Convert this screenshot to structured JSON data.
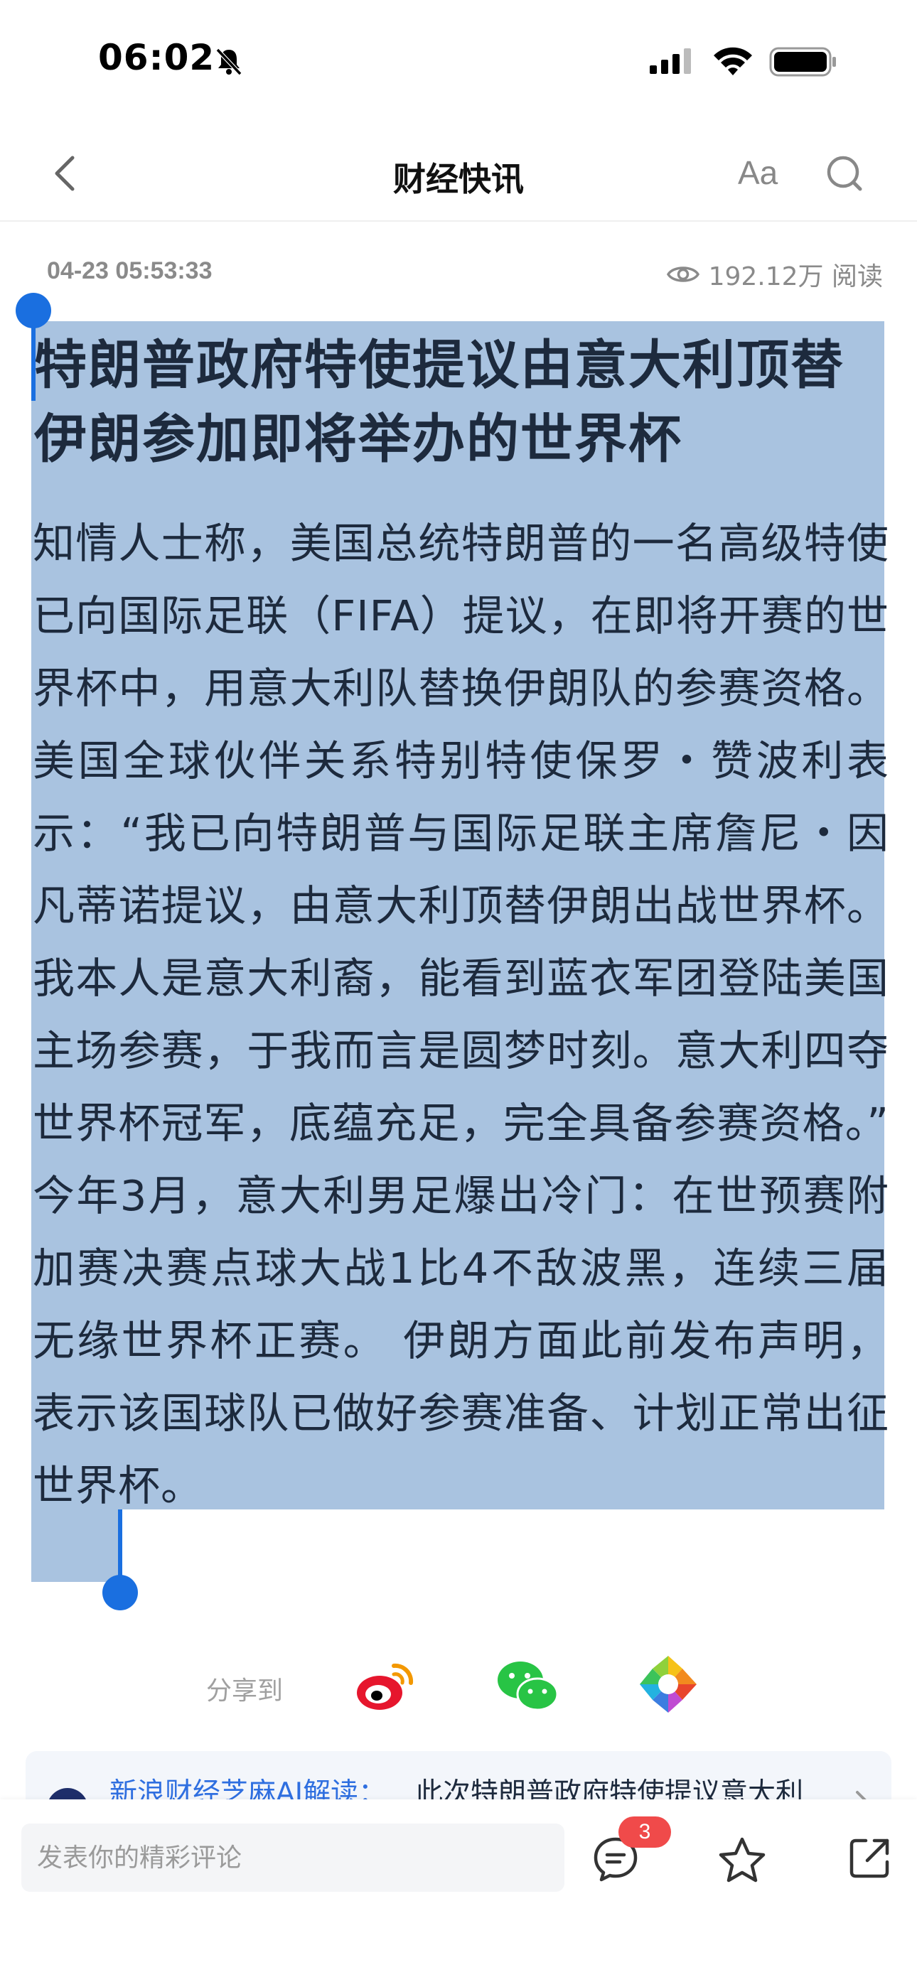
{
  "status_bar": {
    "time": "06:02"
  },
  "nav": {
    "title": "财经快讯",
    "font_size_label": "Aa"
  },
  "meta": {
    "date": "04-23 05:53:33",
    "views": "192.12万 阅读"
  },
  "article": {
    "title": "特朗普政府特使提议由意大利顶替伊朗参加即将举办的世界杯",
    "body": "知情人士称，美国总统特朗普的一名高级特使已向国际足联（FIFA）提议，在即将开赛的世界杯中，用意大利队替换伊朗队的参赛资格。 美国全球伙伴关系特别特使保罗・赞波利表示：“我已向特朗普与国际足联主席詹尼・因凡蒂诺提议，由意大利顶替伊朗出战世界杯。我本人是意大利裔，能看到蓝衣军团登陆美国主场参赛，于我而言是圆梦时刻。意大利四夺世界杯冠军，底蕴充足，完全具备参赛资格。” 今年3月，意大利男足爆出冷门：在世预赛附加赛决赛点球大战1比4不敌波黑，连续三届无缘世界杯正赛。 伊朗方面此前发布声明，表示该国球队已做好参赛准备、计划正常出征世界杯。"
  },
  "share": {
    "label": "分享到",
    "targets": [
      "weibo-icon",
      "wechat-icon",
      "moments-icon"
    ]
  },
  "ai_card": {
    "label": "新浪财经芝麻AI解读：",
    "text": "此次特朗普政府特使提议意大利"
  },
  "bottom_bar": {
    "comment_placeholder": "发表你的精彩评论",
    "comment_count": "3"
  },
  "colors": {
    "selection": "#a9c3e0",
    "handle": "#1a6fe0",
    "badge": "#f04a4a",
    "link": "#2f6fe0"
  }
}
